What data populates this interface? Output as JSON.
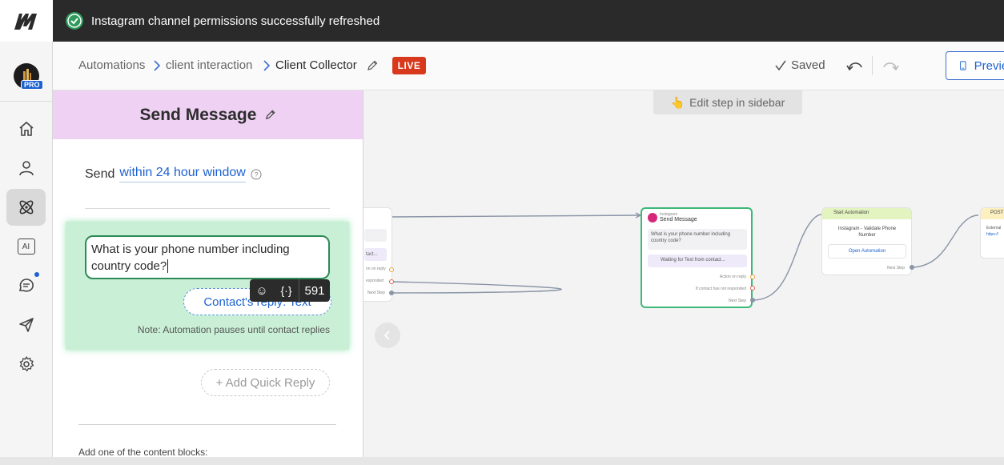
{
  "toast": {
    "message": "Instagram channel permissions successfully refreshed"
  },
  "sidebar_nav": {
    "avatar_badge": "PRO",
    "ai_label": "AI"
  },
  "breadcrumb": {
    "items": [
      "Automations",
      "client interaction",
      "Client Collector"
    ],
    "live_badge": "LIVE"
  },
  "header": {
    "saved_label": "Saved",
    "preview_label": "Preview"
  },
  "panel": {
    "title": "Send Message",
    "send_prefix": "Send",
    "send_window": "within 24 hour window",
    "message_text": "What is your phone number including country code?",
    "reply_chip": "Contact's reply: Text",
    "char_count": "591",
    "emoji_tool": "☺",
    "variable_tool": "{·}",
    "note": "Note: Automation pauses until contact replies",
    "quick_reply": "+ Add Quick Reply",
    "add_blocks": "Add one of the content blocks:"
  },
  "canvas": {
    "edit_hint": "Edit step in sidebar",
    "left_node": {
      "contact_label": "tact...",
      "action_label": "on on reply",
      "responded_label": "esponded",
      "next_label": "Next Step"
    },
    "send_node": {
      "channel": "Instagram",
      "title": "Send Message",
      "text": "What is your phone number including country code?",
      "waiting": "Waiting for Text from contact...",
      "action": "Action on reply",
      "not_responded": "If contact has not responded",
      "next": "Next Step"
    },
    "start_node": {
      "title": "Start Automation",
      "target": "Instagram - Validate Phone Number",
      "open_link": "Open Automation",
      "next": "Next Step"
    },
    "post_node": {
      "title": "POST",
      "line1": "External",
      "line2": "https://"
    }
  },
  "colors": {
    "accent_blue": "#1d62cf",
    "live_red": "#d8391c",
    "panel_header": "#efd1f3",
    "message_block": "#c9f0d6",
    "node_green_border": "#3cb878"
  }
}
